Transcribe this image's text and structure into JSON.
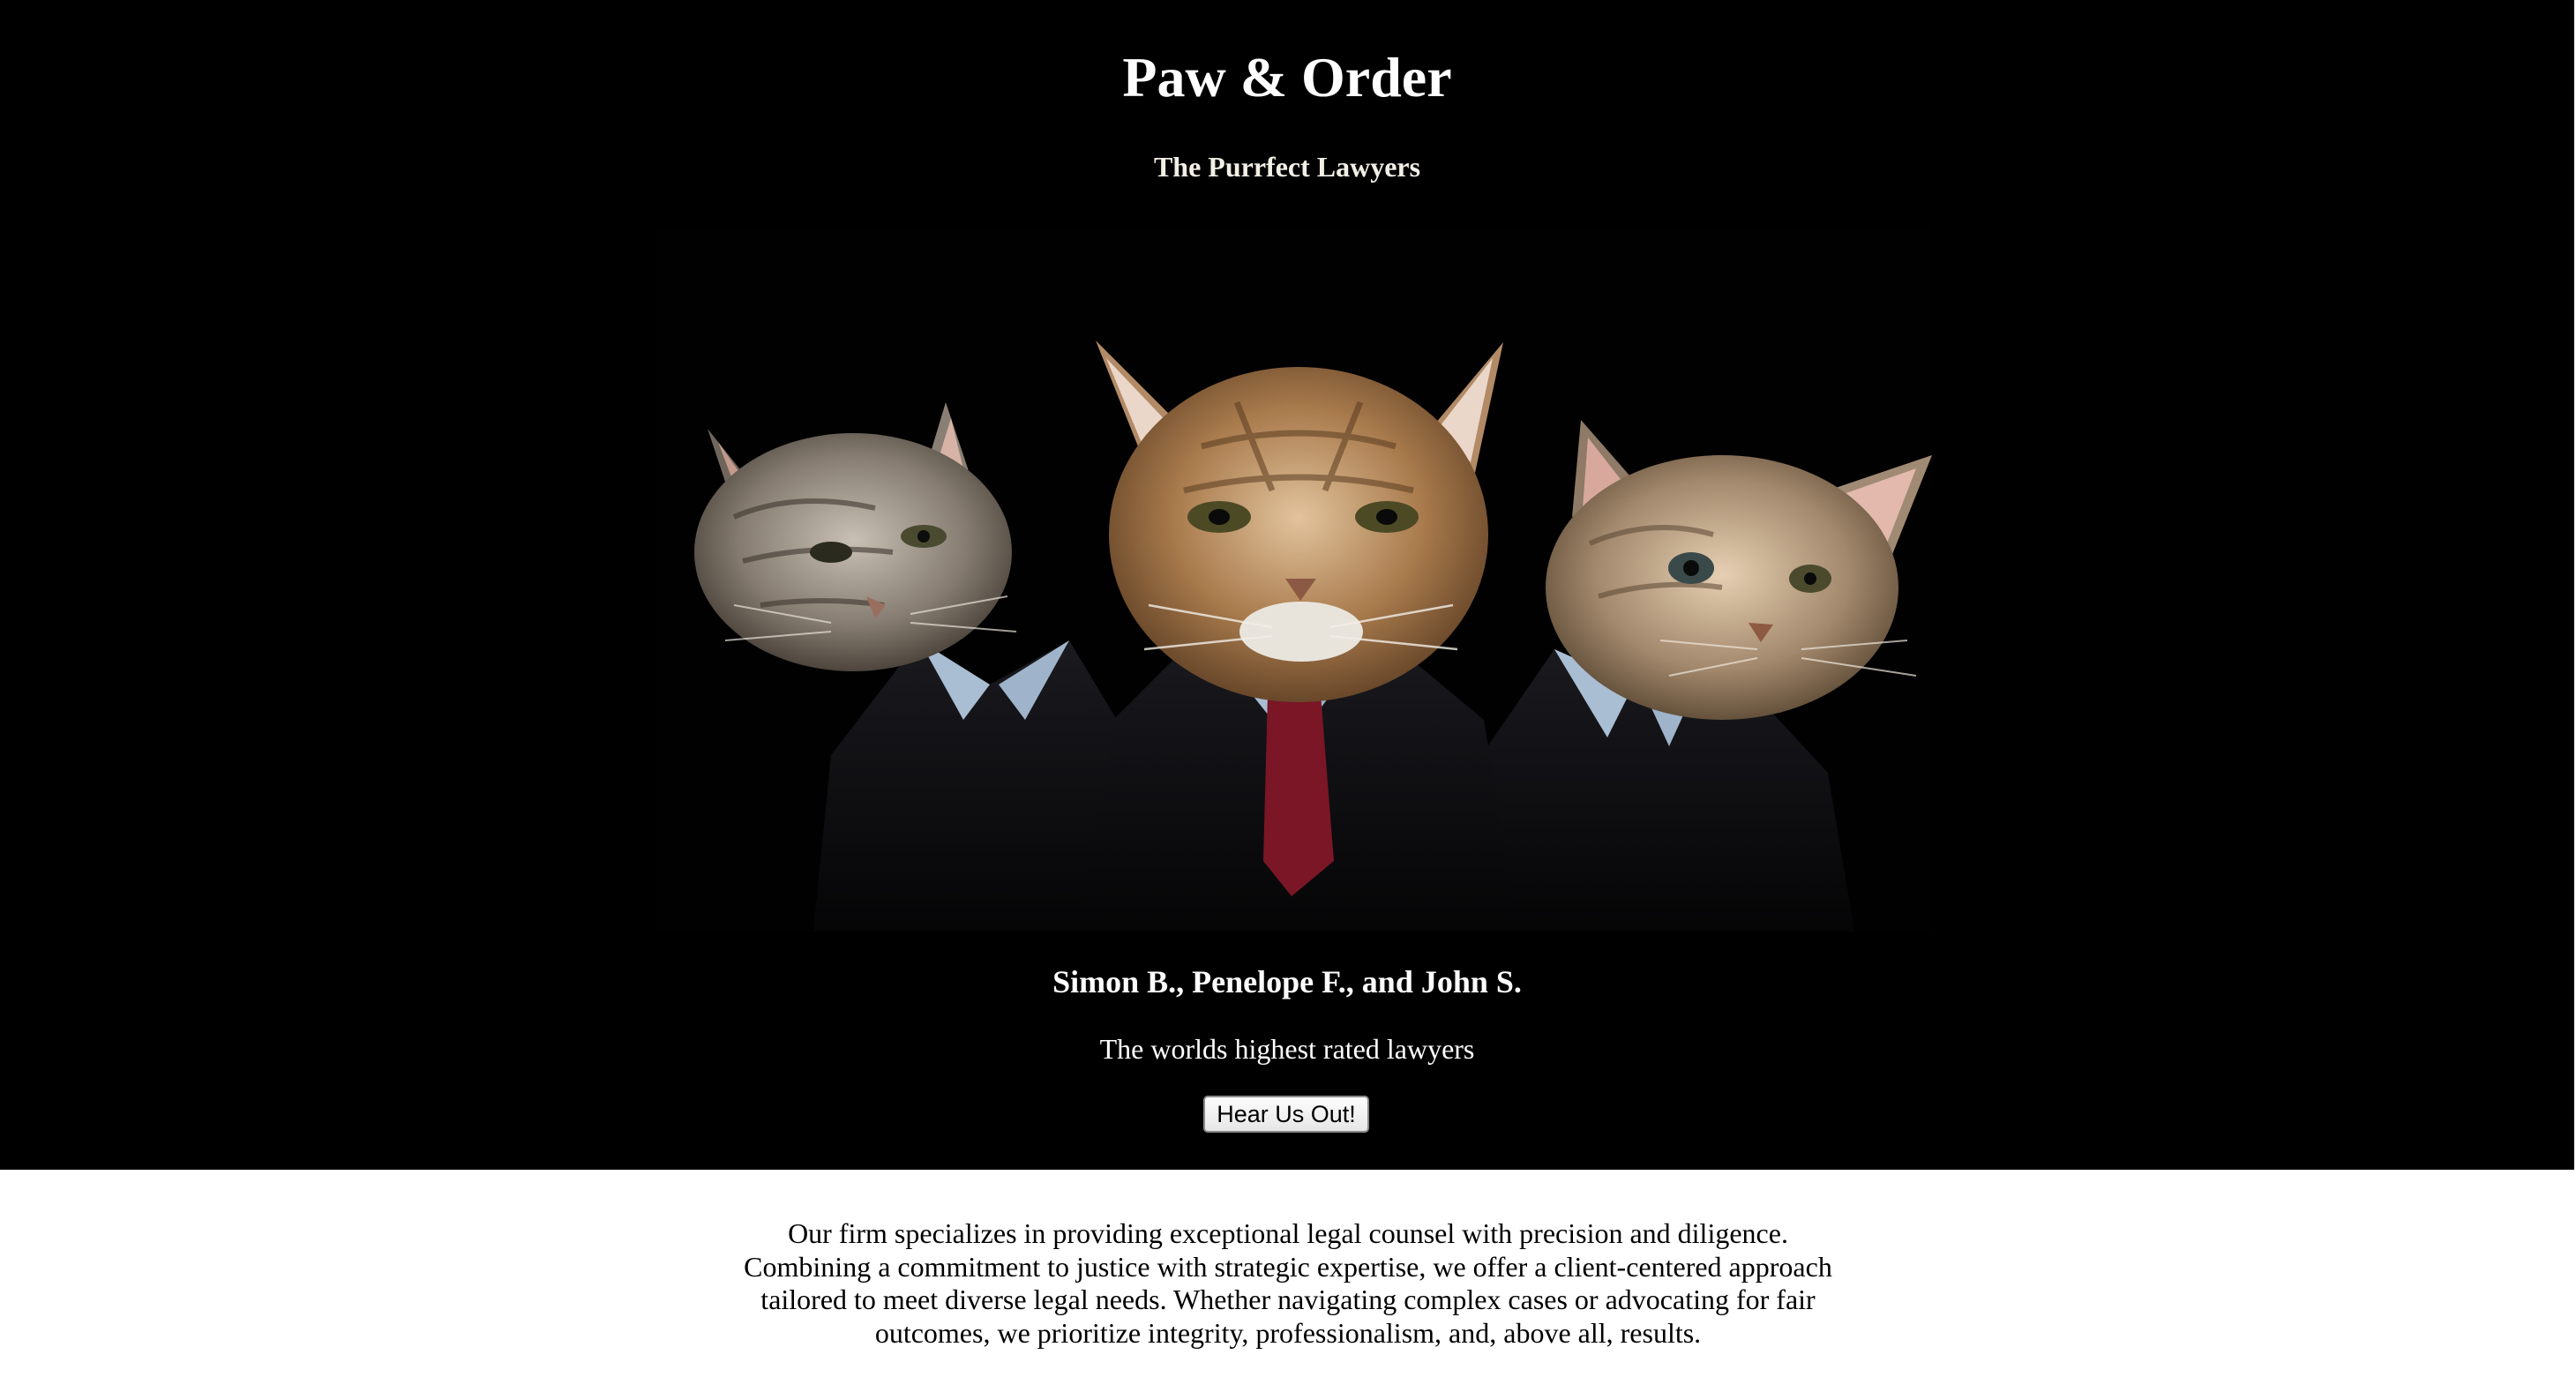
{
  "hero": {
    "title": "Paw & Order",
    "subtitle": "The Purrfect Lawyers",
    "photo_alt": "Three cats dressed in business suits",
    "names": "Simon B., Penelope F., and John S.",
    "tagline": "The worlds highest rated lawyers",
    "cta_label": "Hear Us Out!"
  },
  "about": {
    "text": "Our firm specializes in providing exceptional legal counsel with precision and diligence. Combining a commitment to justice with strategic expertise, we offer a client-centered approach tailored to meet diverse legal needs. Whether navigating complex cases or advocating for fair outcomes, we prioritize integrity, professionalism, and, above all, results."
  },
  "colors": {
    "hero_background": "#000000",
    "page_background": "#ffffff",
    "hero_text": "#ffffff",
    "subtitle_text": "#f2efe6",
    "tie": "#7a1626",
    "shirt": "#a9bdd3"
  }
}
